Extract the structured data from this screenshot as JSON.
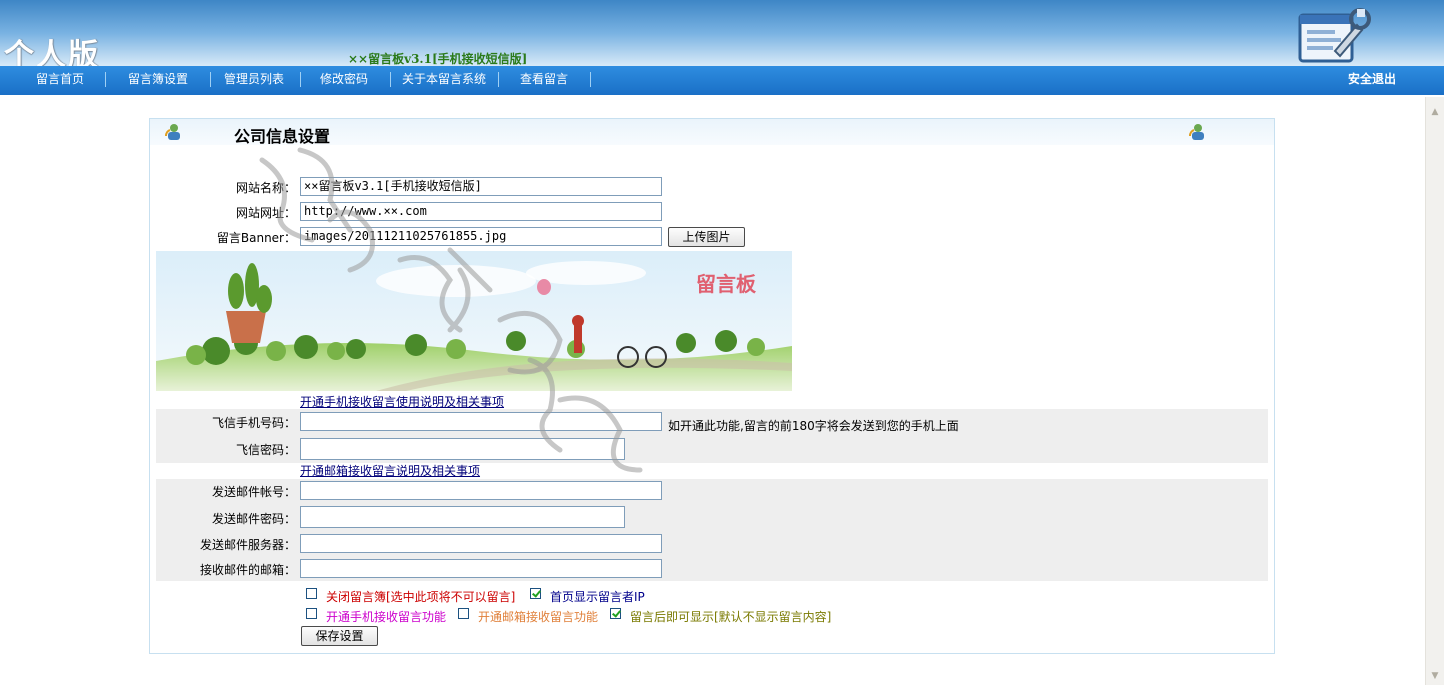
{
  "header": {
    "logo_text": "个人版",
    "app_title": "××留言板v3.1[手机接收短信版]"
  },
  "nav": {
    "items": [
      "留言首页",
      "留言簿设置",
      "管理员列表",
      "修改密码",
      "关于本留言系统",
      "查看留言"
    ],
    "logout": "安全退出"
  },
  "panel": {
    "title": "公司信息设置"
  },
  "form": {
    "site_name_label": "网站名称：",
    "site_name_value": "××留言板v3.1[手机接收短信版]",
    "site_url_label": "网站网址：",
    "site_url_value": "http://www.××.com",
    "banner_label": "留言Banner：",
    "banner_value": "images/20111211025761855.jpg",
    "upload_button": "上传图片",
    "banner_text": "留言板",
    "sms_help_link": "开通手机接收留言使用说明及相关事项",
    "fetion_phone_label": "飞信手机号码：",
    "fetion_phone_value": "",
    "fetion_phone_note": "如开通此功能,留言的前180字将会发送到您的手机上面",
    "fetion_password_label": "飞信密码：",
    "fetion_password_value": "",
    "mail_help_link": "开通邮箱接收留言说明及相关事项",
    "send_account_label": "发送邮件帐号：",
    "send_account_value": "",
    "send_password_label": "发送邮件密码：",
    "send_password_value": "",
    "smtp_label": "发送邮件服务器：",
    "smtp_value": "",
    "receive_mail_label": "接收邮件的邮箱：",
    "receive_mail_value": "",
    "options": [
      {
        "label": "关闭留言簿[选中此项将不可以留言]",
        "checked": false,
        "color": "#cc0000"
      },
      {
        "label": "首页显示留言者IP",
        "checked": true,
        "color": "#00008b"
      },
      {
        "label": "开通手机接收留言功能",
        "checked": false,
        "color": "#cc00cc"
      },
      {
        "label": "开通邮箱接收留言功能",
        "checked": false,
        "color": "#e0803a"
      },
      {
        "label": "留言后即可显示[默认不显示留言内容]",
        "checked": true,
        "color": "#7a7a00"
      }
    ],
    "save_button": "保存设置"
  },
  "colors": {
    "nav_bg": "#1f78cf",
    "link": "#00007a",
    "panel_border": "#c7e0f0"
  },
  "icons": [
    "tools-window-icon",
    "user-refresh-icon"
  ]
}
